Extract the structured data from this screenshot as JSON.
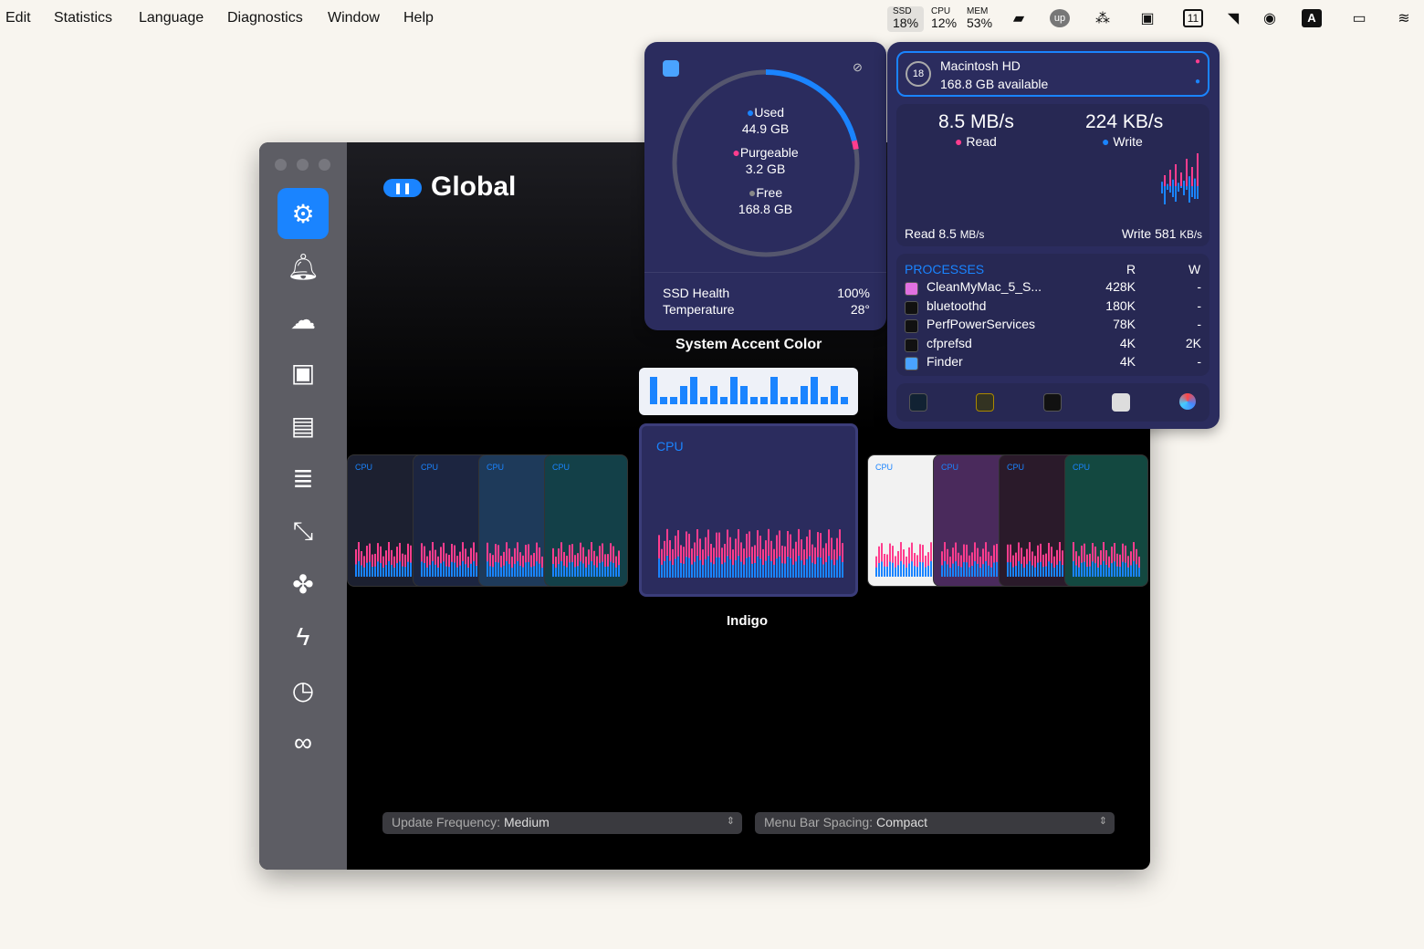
{
  "menubar": {
    "items": [
      "Edit",
      "Statistics",
      "Language",
      "Diagnostics",
      "Window",
      "Help"
    ],
    "stats": [
      {
        "label": "SSD",
        "value": "18%"
      },
      {
        "label": "CPU",
        "value": "12%"
      },
      {
        "label": "MEM",
        "value": "53%"
      }
    ],
    "calendar_day": "11",
    "input_source": "A"
  },
  "window": {
    "title": "Global",
    "sidebar": [
      "gear-icon",
      "bell-icon",
      "weather-icon",
      "cpu-icon",
      "memory-icon",
      "disk-icon",
      "network-icon",
      "fan-icon",
      "battery-icon",
      "clock-icon",
      "rings-icon"
    ],
    "theme_label": "System Accent Color",
    "selected_theme": "Indigo",
    "card_label": "CPU",
    "update_frequency": {
      "label": "Update Frequency:",
      "value": "Medium"
    },
    "menu_spacing": {
      "label": "Menu Bar Spacing:",
      "value": "Compact"
    }
  },
  "storage": {
    "used_label": "Used",
    "used": "44.9 GB",
    "purgeable_label": "Purgeable",
    "purgeable": "3.2 GB",
    "free_label": "Free",
    "free": "168.8 GB",
    "used_fraction": 0.21,
    "purgeable_fraction": 0.015,
    "health_label": "SSD Health",
    "health": "100%",
    "temp_label": "Temperature",
    "temp": "28°"
  },
  "disk": {
    "badge": "18",
    "name": "Macintosh HD",
    "available": "168.8 GB available",
    "read_rate": "8.5 MB/s",
    "read_label": "Read",
    "write_rate": "224 KB/s",
    "write_label": "Write",
    "read_footer_label": "Read",
    "read_footer": "8.5",
    "read_footer_unit": "MB/s",
    "write_footer_label": "Write",
    "write_footer": "581",
    "write_footer_unit": "KB/s",
    "processes_header": "PROCESSES",
    "col_r": "R",
    "col_w": "W",
    "processes": [
      {
        "name": "CleanMyMac_5_S...",
        "r": "428K",
        "w": "-"
      },
      {
        "name": "bluetoothd",
        "r": "180K",
        "w": "-"
      },
      {
        "name": "PerfPowerServices",
        "r": "78K",
        "w": "-"
      },
      {
        "name": "cfprefsd",
        "r": "4K",
        "w": "2K"
      },
      {
        "name": "Finder",
        "r": "4K",
        "w": "-"
      }
    ]
  },
  "colors": {
    "accent": "#1a84ff",
    "pink": "#ff3d8e",
    "popup": "#2b2c5e"
  }
}
